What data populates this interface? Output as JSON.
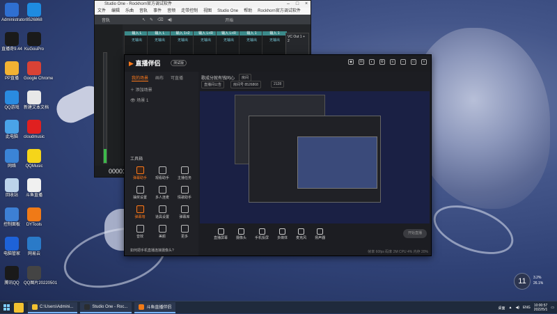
{
  "desktop": {
    "icons": [
      {
        "label": "Administrator",
        "color": "#2f6fd1"
      },
      {
        "label": "8526868",
        "color": "#1e8be0"
      },
      {
        "label": "直播奇9.44",
        "color": "#1a1a1a"
      },
      {
        "label": "KuGouPro",
        "color": "#1a1a1a"
      },
      {
        "label": "PP直播",
        "color": "#f2b233"
      },
      {
        "label": "Google Chrome",
        "color": "#d94235"
      },
      {
        "label": "QQ游戏",
        "color": "#2a8be0"
      },
      {
        "label": "新建文本文档",
        "color": "#e8e8e8"
      },
      {
        "label": "此电脑",
        "color": "#4aa3e8"
      },
      {
        "label": "cloudmusic",
        "color": "#e02020"
      },
      {
        "label": "网络",
        "color": "#3b84d6"
      },
      {
        "label": "QQMusic",
        "color": "#f5d51a"
      },
      {
        "label": "回收站",
        "color": "#bcd3ea"
      },
      {
        "label": "斗鱼直播",
        "color": "#f0f0f0"
      },
      {
        "label": "控制面板",
        "color": "#3d7fd4"
      },
      {
        "label": "DYTools",
        "color": "#f07a17"
      },
      {
        "label": "电脑管家",
        "color": "#1e62d8"
      },
      {
        "label": "网易云",
        "color": "#2a7ac8"
      },
      {
        "label": "腾讯QQ",
        "color": "#1a1a1a"
      },
      {
        "label": "QQ图片20220501",
        "color": "#444444"
      }
    ]
  },
  "studio": {
    "title": "Studio One - Rockhorn官方调试软件",
    "menu": [
      "文件",
      "编辑",
      "乐曲",
      "音轨",
      "事件",
      "音频",
      "走带控制",
      "视图",
      "Studio One",
      "帮助",
      "Rockhorn官方调试软件"
    ],
    "tools_label": "音轨",
    "start_label": "开始",
    "timecode": "00001",
    "channels": [
      "输入 L",
      "输入 L",
      "输入 1+2",
      "输入 L+R",
      "输入 L+R",
      "输入 1",
      "输入 1"
    ],
    "channel_value": "无输出",
    "vc_label": "VC Out 1 + 2"
  },
  "helper": {
    "logo_icon": "直播伴侣",
    "logo_text": "直播伴侣",
    "version": "测试版",
    "tabs": [
      "我的场景",
      "画布",
      "可直播"
    ],
    "scene_add": "添加场景",
    "scene_name": "场景 1",
    "room_title": "歌成分就有钱同心",
    "room_tag": "房间",
    "chips": [
      "直播间公告",
      "房间号 8526868",
      "2128"
    ],
    "tools_title": "工具箱",
    "tools": [
      {
        "label": "弹幕助手",
        "hot": true
      },
      {
        "label": "观看助手",
        "hot": false
      },
      {
        "label": "主播任务",
        "hot": false
      },
      {
        "label": "抽奖设置",
        "hot": false
      },
      {
        "label": "多人连麦",
        "hot": false
      },
      {
        "label": "情歌助手",
        "hot": false
      },
      {
        "label": "弹幕墙",
        "hot": true
      },
      {
        "label": "道具设置",
        "hot": false
      },
      {
        "label": "弹幕库",
        "hot": false
      },
      {
        "label": "音效",
        "hot": false
      },
      {
        "label": "美颜",
        "hot": false
      },
      {
        "label": "更多",
        "hot": false
      }
    ],
    "tip": "如何把手机直播连接摄像头?",
    "controls": [
      "直播屏幕",
      "摄像头",
      "手机投屏",
      "多媒体",
      "麦克风",
      "扬声器"
    ],
    "start_button": "开始直播",
    "stats": "帧率 60fps  码率 2M  CPU 4%  内存 20%"
  },
  "weather": {
    "temp": "11",
    "line1": "3.2%",
    "line2": "26.1%"
  },
  "taskbar": {
    "tasks": [
      {
        "label": "C:\\Users\\Admini...",
        "color": "#f2c230"
      },
      {
        "label": "Studio One - Roc...",
        "color": "#2a2d31"
      },
      {
        "label": "斗鱼直播伴侣",
        "color": "#f07a17"
      }
    ],
    "tray_label": "桌面",
    "lang": "ENG",
    "time": "10:00:57",
    "date": "2022/5/1"
  }
}
